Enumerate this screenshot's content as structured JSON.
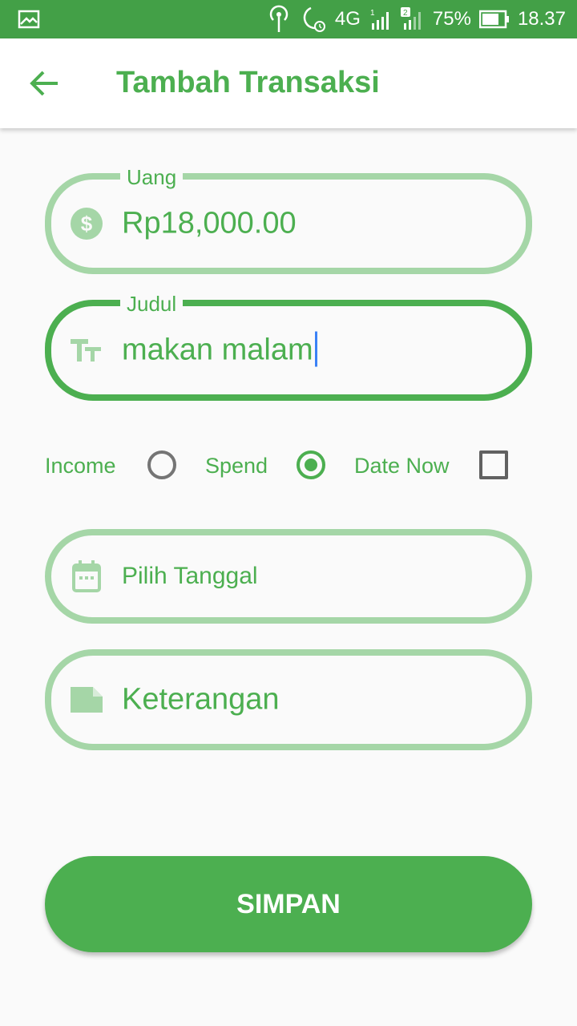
{
  "status_bar": {
    "network": "4G",
    "sim1": "1",
    "sim2": "2",
    "battery": "75%",
    "time": "18.37"
  },
  "appbar": {
    "back_icon": "arrow-left-icon",
    "title": "Tambah Transaksi"
  },
  "form": {
    "amount": {
      "legend": "Uang",
      "value": "Rp18,000.00",
      "icon": "dollar-circle-icon"
    },
    "title": {
      "legend": "Judul",
      "value": "makan malam",
      "icon": "text-format-icon"
    },
    "type": {
      "income_label": "Income",
      "income_checked": false,
      "spend_label": "Spend",
      "spend_checked": true,
      "date_now_label": "Date Now",
      "date_now_checked": false
    },
    "date": {
      "placeholder": "Pilih Tanggal",
      "icon": "calendar-icon"
    },
    "note": {
      "placeholder": "Keterangan",
      "icon": "note-icon"
    }
  },
  "save_label": "SIMPAN",
  "colors": {
    "primary": "#4caf50",
    "status_bar": "#43a047",
    "field_border": "#a5d6a7",
    "caret": "#3b82f6"
  }
}
